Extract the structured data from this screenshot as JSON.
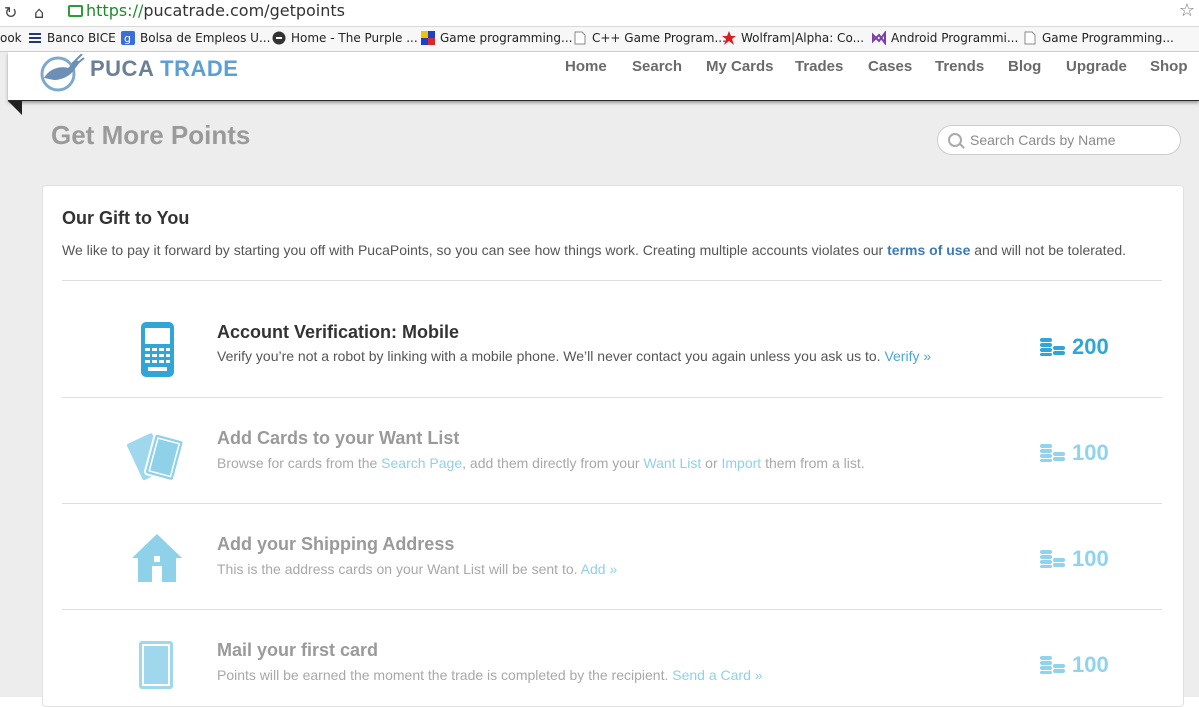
{
  "browser": {
    "url_scheme": "https://",
    "url_rest": "pucatrade.com/getpoints",
    "bookmarks": [
      {
        "label": "ook",
        "icon": "none"
      },
      {
        "label": "Banco BICE",
        "icon": "bars-icon"
      },
      {
        "label": "Bolsa de Empleos U...",
        "icon": "google-icon"
      },
      {
        "label": "Home - The Purple ...",
        "icon": "circle-icon"
      },
      {
        "label": "Game programming...",
        "icon": "flag-icon"
      },
      {
        "label": "C++ Game Program...",
        "icon": "page-icon"
      },
      {
        "label": "Wolfram|Alpha: Co...",
        "icon": "star-burst-icon"
      },
      {
        "label": "Android Programmi...",
        "icon": "vs-icon"
      },
      {
        "label": "Game Programming...",
        "icon": "page-icon"
      }
    ]
  },
  "site": {
    "logo_puca": "PUCA",
    "logo_trade": " TRADE",
    "nav": [
      "Home",
      "Search",
      "My Cards",
      "Trades",
      "Cases",
      "Trends",
      "Blog",
      "Upgrade",
      "Shop"
    ],
    "page_title": "Get More Points",
    "search_placeholder": "Search Cards by Name"
  },
  "gift": {
    "title": "Our Gift to You",
    "desc_before": "We like to pay it forward by starting you off with PucaPoints, so you can see how things work. Creating multiple accounts violates our ",
    "desc_link": "terms of use",
    "desc_after": " and will not be tolerated."
  },
  "rows": [
    {
      "title": "Account Verification: Mobile",
      "desc_1": "Verify you’re not a robot by linking with a mobile phone. We’ll never contact you again unless you ask us to. ",
      "link_1": "Verify »",
      "points": "200",
      "icon": "mobile-phone-icon"
    },
    {
      "title": "Add Cards to your Want List",
      "desc_1": "Browse for cards from the ",
      "link_1": "Search Page",
      "desc_2": ", add them directly from your ",
      "link_2": "Want List",
      "desc_3": " or ",
      "link_3": "Import",
      "desc_4": " them from a list.",
      "points": "100",
      "icon": "cards-icon"
    },
    {
      "title": "Add your Shipping Address",
      "desc_1": "This is the address cards on your Want List will be sent to. ",
      "link_1": "Add »",
      "points": "100",
      "icon": "house-icon"
    },
    {
      "title": "Mail your first card",
      "desc_1": "Points will be earned the moment the trade is completed by the recipient. ",
      "link_1": "Send a Card »",
      "points": "100",
      "icon": "card-icon"
    }
  ],
  "colors": {
    "accent": "#2fa6d6",
    "muted_accent": "#8fd3ec",
    "link": "#3b7bb5"
  }
}
